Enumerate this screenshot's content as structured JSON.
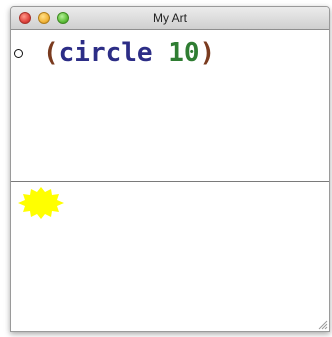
{
  "window": {
    "title": "My Art"
  },
  "editor": {
    "open_paren": "(",
    "function_name": "circle",
    "argument": "10",
    "close_paren": ")"
  },
  "colors": {
    "paren": "#7a3b1f",
    "function_name": "#2c2d86",
    "argument": "#2f7d32",
    "starburst": "#ffff00"
  },
  "icons": {
    "close": "close-icon",
    "minimize": "minimize-icon",
    "zoom": "zoom-icon",
    "bullet": "circle-outline-icon",
    "resize": "resize-grip-icon"
  }
}
